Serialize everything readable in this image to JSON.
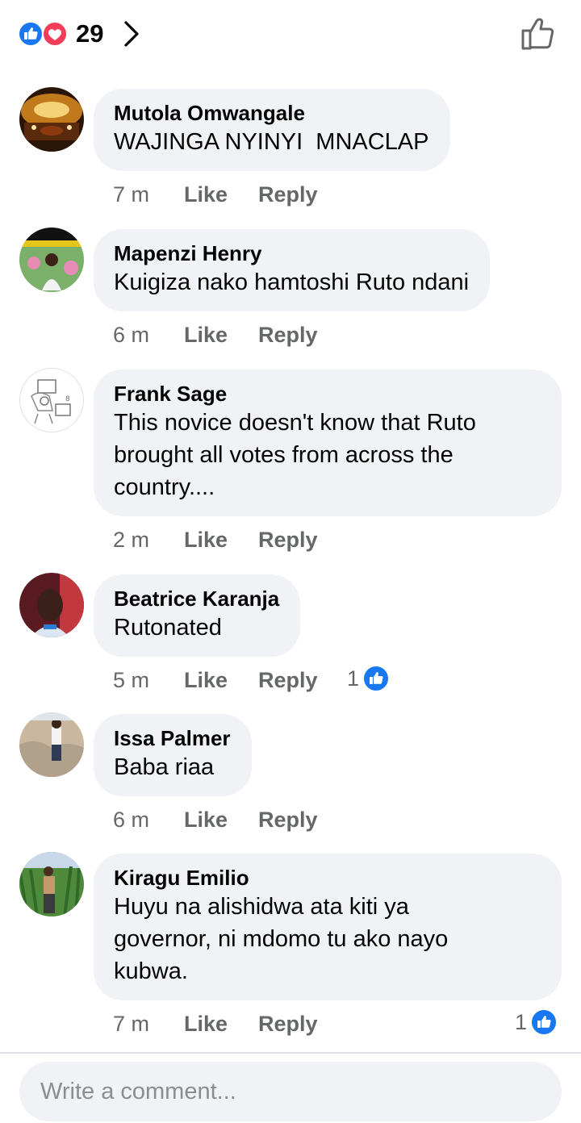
{
  "header": {
    "reaction_count": "29",
    "reactions": [
      "like-icon",
      "love-icon"
    ],
    "colors": {
      "like": "#1877f2",
      "love": "#f33e58"
    }
  },
  "comments": [
    {
      "author": "Mutola Omwangale",
      "text": "WAJINGA NYINYI  MNACLAP",
      "time": "7 m",
      "like_label": "Like",
      "reply_label": "Reply",
      "reactions": ""
    },
    {
      "author": "Mapenzi Henry",
      "text": "Kuigiza nako hamtoshi Ruto ndani",
      "time": "6 m",
      "like_label": "Like",
      "reply_label": "Reply",
      "reactions": ""
    },
    {
      "author": "Frank Sage",
      "text": "This novice doesn't know that Ruto\nbrought all votes from across the\ncountry....",
      "time": "2 m",
      "like_label": "Like",
      "reply_label": "Reply",
      "reactions": ""
    },
    {
      "author": "Beatrice Karanja",
      "text": "Rutonated",
      "time": "5 m",
      "like_label": "Like",
      "reply_label": "Reply",
      "reactions": "1"
    },
    {
      "author": "Issa Palmer",
      "text": "Baba riaa",
      "time": "6 m",
      "like_label": "Like",
      "reply_label": "Reply",
      "reactions": ""
    },
    {
      "author": "Kiragu Emilio",
      "text": "Huyu na alishidwa ata kiti ya\ngovernor, ni mdomo tu ako nayo\nkubwa.",
      "time": "7 m",
      "like_label": "Like",
      "reply_label": "Reply",
      "reactions": "1"
    }
  ],
  "composer": {
    "placeholder": "Write a comment..."
  }
}
